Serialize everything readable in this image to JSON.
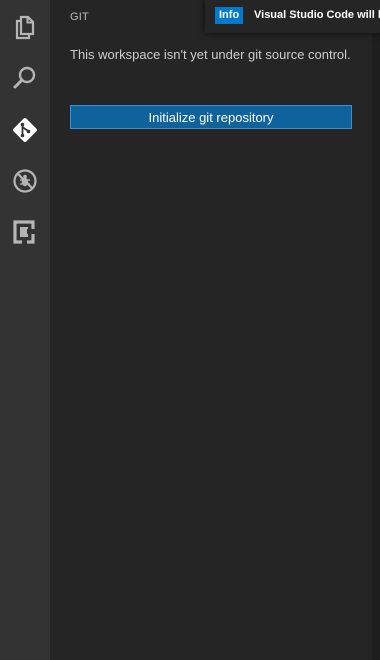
{
  "activity_bar": {
    "items": [
      {
        "icon": "files-icon",
        "active": false
      },
      {
        "icon": "search-icon",
        "active": false
      },
      {
        "icon": "git-icon",
        "active": true
      },
      {
        "icon": "debug-icon",
        "active": false
      },
      {
        "icon": "extensions-icon",
        "active": false
      }
    ],
    "colors": {
      "active": "#ffffff",
      "inactive": "#b5b5b5",
      "background": "#333333"
    }
  },
  "sidebar": {
    "title": "GIT",
    "message": "This workspace isn't yet under git source control.",
    "init_button_label": "Initialize git repository"
  },
  "notification": {
    "badge": "Info",
    "text": "Visual Studio Code will b"
  },
  "colors": {
    "button_bg": "#0e639c",
    "button_border": "#3c8fd6",
    "badge_bg": "#007acc",
    "sidebar_bg": "#252526"
  }
}
